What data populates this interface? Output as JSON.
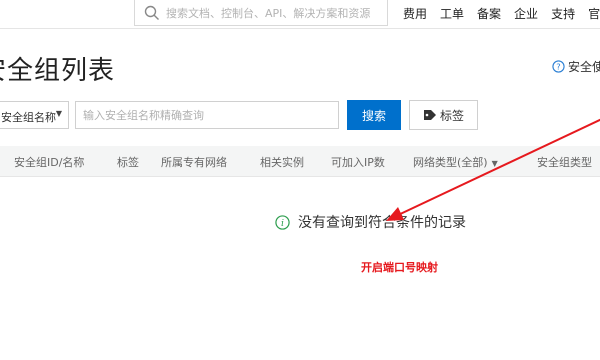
{
  "topbar": {
    "search_placeholder": "搜索文档、控制台、API、解决方案和资源",
    "nav": [
      "费用",
      "工单",
      "备案",
      "企业",
      "支持",
      "官网"
    ]
  },
  "page": {
    "title": "安全组列表",
    "help_link": "安全使"
  },
  "filter": {
    "select_value": "安全组名称",
    "input_placeholder": "输入安全组名称精确查询",
    "search_button": "搜索",
    "tag_button": "标签"
  },
  "table": {
    "columns": [
      "安全组ID/名称",
      "标签",
      "所属专有网络",
      "相关实例",
      "可加入IP数",
      "网络类型(全部)",
      "安全组类型"
    ]
  },
  "empty": {
    "message": "没有查询到符合条件的记录"
  },
  "annotation": {
    "text": "开启端口号映射",
    "color": "#e6191e"
  },
  "colors": {
    "primary_button": "#0070cc",
    "info_icon": "#2e9e4f",
    "help_icon": "#2a7fd4"
  }
}
